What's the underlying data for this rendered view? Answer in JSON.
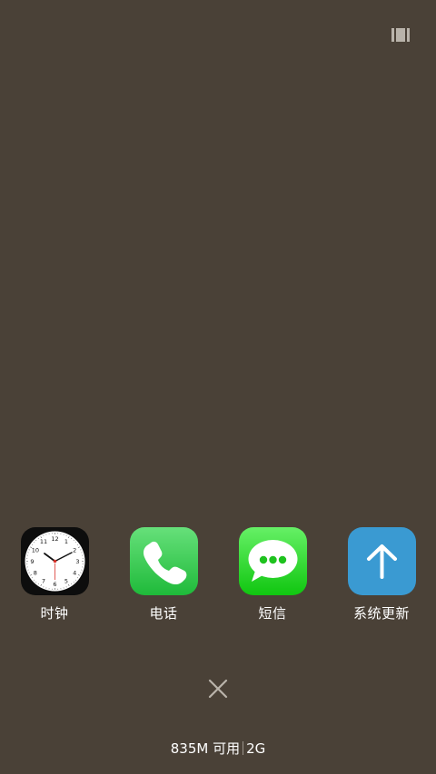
{
  "apps": [
    {
      "label": "时钟",
      "icon": "clock-icon"
    },
    {
      "label": "电话",
      "icon": "phone-icon"
    },
    {
      "label": "短信",
      "icon": "message-bubble-icon"
    },
    {
      "label": "系统更新",
      "icon": "arrow-up-icon"
    }
  ],
  "memory": {
    "available": "835M 可用",
    "total": "2G"
  },
  "clock_face": {
    "numbers": [
      "12",
      "1",
      "2",
      "3",
      "4",
      "5",
      "6",
      "7",
      "8",
      "9",
      "10",
      "11"
    ]
  },
  "colors": {
    "background": "#4a4137",
    "phone_green": "#1fba3a",
    "sms_green": "#10c610",
    "update_blue": "#3a9ad2"
  }
}
